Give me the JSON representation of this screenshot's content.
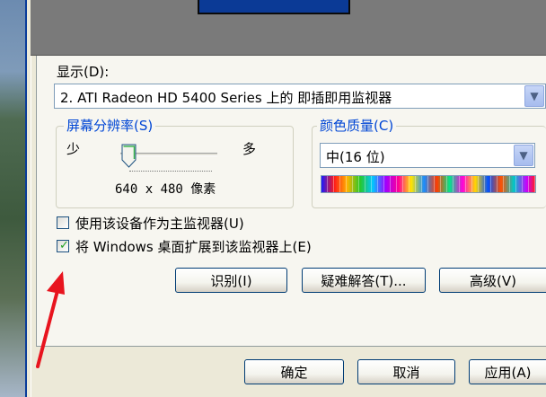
{
  "display": {
    "label": "显示(D):",
    "selected": "2. ATI Radeon HD 5400 Series 上的 即插即用监视器"
  },
  "resolution": {
    "title": "屏幕分辨率(S)",
    "less_label": "少",
    "more_label": "多",
    "value": "640 x 480 像素",
    "slider_level": 0
  },
  "color_quality": {
    "title": "颜色质量(C)",
    "selected": "中(16 位)"
  },
  "options": {
    "primary_label": "使用该设备作为主监视器(U)",
    "primary_checked": false,
    "extend_label": "将 Windows 桌面扩展到该监视器上(E)",
    "extend_checked": true
  },
  "buttons": {
    "identify": "识别(I)",
    "troubleshoot": "疑难解答(T)...",
    "advanced": "高级(V)",
    "ok": "确定",
    "cancel": "取消",
    "apply": "应用(A)"
  },
  "colors": {
    "accent": "#0046d5",
    "window_bg": "#ece9d8",
    "arrow": "#e8141e",
    "check": "#21a121"
  }
}
